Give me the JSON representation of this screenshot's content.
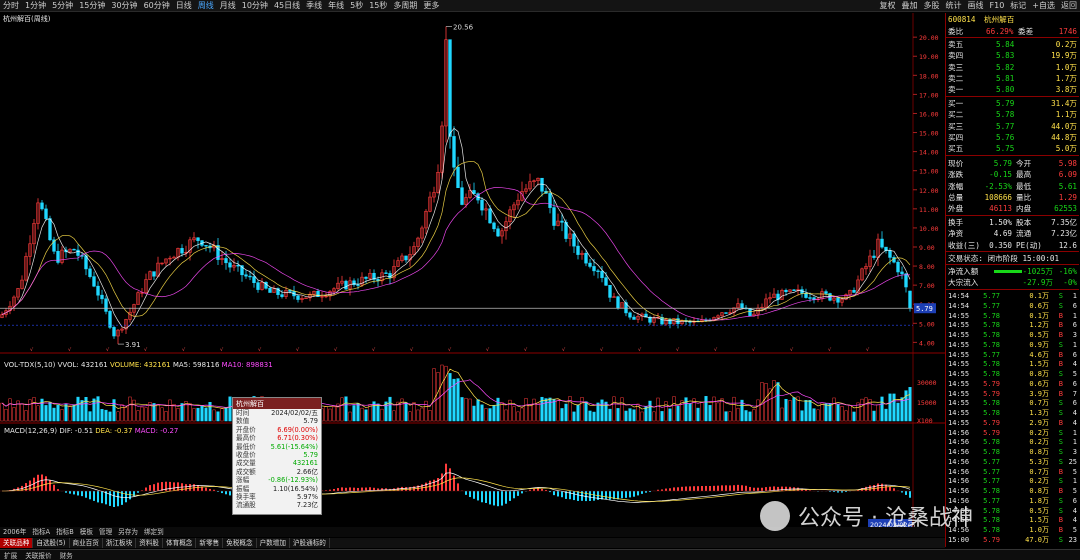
{
  "toolbar": {
    "left": [
      "分时",
      "1分钟",
      "5分钟",
      "15分钟",
      "30分钟",
      "60分钟",
      "日线",
      "周线",
      "月线",
      "10分钟",
      "45日线",
      "季线",
      "年线",
      "5秒",
      "15秒",
      "多周期",
      "更多"
    ],
    "active_index": 7,
    "right": [
      "复权",
      "叠加",
      "多股",
      "统计",
      "画线",
      "F10",
      "标记",
      "+自选",
      "返回"
    ]
  },
  "chart": {
    "title": "杭州解百(周线)",
    "price_high": "20.56",
    "price_low": "3.91",
    "current_price": "5.79",
    "y_ticks": [
      "20.00",
      "19.00",
      "18.00",
      "17.00",
      "16.00",
      "15.00",
      "14.00",
      "13.00",
      "12.00",
      "11.00",
      "10.00",
      "9.00",
      "8.00",
      "7.00",
      "6.00",
      "5.00",
      "4.00"
    ],
    "colors": {
      "up": "#ff3c3c",
      "down": "#20d8ff",
      "ma5": "#ffffff",
      "ma10": "#ffe14a",
      "ma20": "#ff4cff",
      "grid": "#6b0000"
    }
  },
  "volume": {
    "header": "VOL-TDX(5,10) VVOL: 432161",
    "volume_text": "VOLUME: 432161",
    "ma5_text": "MA5: 598116",
    "ma10_text": "MA10: 898831",
    "y_ticks": [
      "30000",
      "15000",
      "X100"
    ]
  },
  "macd": {
    "header": "MACD(12,26,9)",
    "dif_text": "DIF: -0.51",
    "dea_text": "DEA: -0.37",
    "macd_text": "MACD: -0.27"
  },
  "tooltip": {
    "title": "杭州解百",
    "rows": [
      {
        "k": "时间",
        "v": "2024/02/02/五",
        "c": "#222"
      },
      {
        "k": "数值",
        "v": "5.79",
        "c": "#222"
      },
      {
        "k": "开盘价",
        "v": "6.69(0.00%)",
        "c": "#e00000"
      },
      {
        "k": "最高价",
        "v": "6.71(0.30%)",
        "c": "#e00000"
      },
      {
        "k": "最低价",
        "v": "5.61(-15.64%)",
        "c": "#0a0"
      },
      {
        "k": "收盘价",
        "v": "5.79",
        "c": "#0a0"
      },
      {
        "k": "成交量",
        "v": "432161",
        "c": "#0a0"
      },
      {
        "k": "成交额",
        "v": "2.66亿",
        "c": "#222"
      },
      {
        "k": "涨幅",
        "v": "-0.86(-12.93%)",
        "c": "#0a0"
      },
      {
        "k": "振幅",
        "v": "1.10(16.54%)",
        "c": "#222"
      },
      {
        "k": "换手率",
        "v": "5.97%",
        "c": "#222"
      },
      {
        "k": "流通股",
        "v": "7.23亿",
        "c": "#222"
      }
    ]
  },
  "quote": {
    "code": "600814",
    "name": "杭州解百",
    "weibi": {
      "label": "委比",
      "value": "66.29%",
      "label2": "委差",
      "value2": "1746"
    },
    "asks": [
      {
        "label": "卖五",
        "price": "5.84",
        "vol": "0.2万"
      },
      {
        "label": "卖四",
        "price": "5.83",
        "vol": "19.9万"
      },
      {
        "label": "卖三",
        "price": "5.82",
        "vol": "1.0万"
      },
      {
        "label": "卖二",
        "price": "5.81",
        "vol": "1.7万"
      },
      {
        "label": "卖一",
        "price": "5.80",
        "vol": "3.8万"
      }
    ],
    "bids": [
      {
        "label": "买一",
        "price": "5.79",
        "vol": "31.4万"
      },
      {
        "label": "买二",
        "price": "5.78",
        "vol": "1.1万"
      },
      {
        "label": "买三",
        "price": "5.77",
        "vol": "44.0万"
      },
      {
        "label": "买四",
        "price": "5.76",
        "vol": "44.8万"
      },
      {
        "label": "买五",
        "price": "5.75",
        "vol": "5.0万"
      }
    ],
    "stats": [
      {
        "l1": "现价",
        "v1": "5.79",
        "c1": "grn",
        "l2": "今开",
        "v2": "5.98",
        "c2": "red"
      },
      {
        "l1": "涨跌",
        "v1": "-0.15",
        "c1": "grn",
        "l2": "最高",
        "v2": "6.09",
        "c2": "red"
      },
      {
        "l1": "涨幅",
        "v1": "-2.53%",
        "c1": "grn",
        "l2": "最低",
        "v2": "5.61",
        "c2": "grn"
      },
      {
        "l1": "总量",
        "v1": "108666",
        "c1": "yel",
        "l2": "量比",
        "v2": "1.29",
        "c2": "red"
      },
      {
        "l1": "外盘",
        "v1": "46113",
        "c1": "red",
        "l2": "内盘",
        "v2": "62553",
        "c2": "grn"
      }
    ],
    "stats2": [
      {
        "l1": "换手",
        "v1": "1.50%",
        "l2": "股本",
        "v2": "7.35亿"
      },
      {
        "l1": "净资",
        "v1": "4.69",
        "l2": "流通",
        "v2": "7.23亿"
      },
      {
        "l1": "收益(三)",
        "v1": "0.350",
        "l2": "PE(动)",
        "v2": "12.6"
      }
    ],
    "trade_status": "交易状态: 闭市阶段 15:00:01",
    "flow": [
      {
        "label": "净流入额",
        "value": "-1025万",
        "pct": "-16%"
      },
      {
        "label": "大宗流入",
        "value": "-27.9万",
        "pct": "-0%"
      }
    ],
    "ticks": [
      [
        "14:54",
        "5.77",
        "0.1万",
        "S",
        "1"
      ],
      [
        "14:54",
        "5.77",
        "0.6万",
        "S",
        "6"
      ],
      [
        "14:55",
        "5.78",
        "0.1万",
        "B",
        "1"
      ],
      [
        "14:55",
        "5.78",
        "1.2万",
        "B",
        "6"
      ],
      [
        "14:55",
        "5.78",
        "0.5万",
        "B",
        "3"
      ],
      [
        "14:55",
        "5.78",
        "0.9万",
        "S",
        "1"
      ],
      [
        "14:55",
        "5.77",
        "4.6万",
        "B",
        "6"
      ],
      [
        "14:55",
        "5.78",
        "1.5万",
        "B",
        "4"
      ],
      [
        "14:55",
        "5.78",
        "0.8万",
        "S",
        "5"
      ],
      [
        "14:55",
        "5.79",
        "0.6万",
        "B",
        "6"
      ],
      [
        "14:55",
        "5.79",
        "3.9万",
        "B",
        "7"
      ],
      [
        "14:55",
        "5.78",
        "0.7万",
        "S",
        "6"
      ],
      [
        "14:55",
        "5.78",
        "1.3万",
        "S",
        "4"
      ],
      [
        "14:55",
        "5.79",
        "2.9万",
        "B",
        "4"
      ],
      [
        "14:56",
        "5.79",
        "0.2万",
        "S",
        "1"
      ],
      [
        "14:56",
        "5.78",
        "0.2万",
        "S",
        "1"
      ],
      [
        "14:56",
        "5.78",
        "0.8万",
        "S",
        "3"
      ],
      [
        "14:56",
        "5.77",
        "5.3万",
        "S",
        "25"
      ],
      [
        "14:56",
        "5.77",
        "0.7万",
        "B",
        "5"
      ],
      [
        "14:56",
        "5.77",
        "0.2万",
        "S",
        "1"
      ],
      [
        "14:56",
        "5.78",
        "0.8万",
        "B",
        "5"
      ],
      [
        "14:56",
        "5.77",
        "1.8万",
        "S",
        "6"
      ],
      [
        "14:56",
        "5.78",
        "0.5万",
        "S",
        "4"
      ],
      [
        "14:56",
        "5.78",
        "1.5万",
        "B",
        "4"
      ],
      [
        "14:56",
        "5.78",
        "1.0万",
        "B",
        "5"
      ],
      [
        "15:00",
        "5.79",
        "47.0万",
        "S",
        "23"
      ]
    ]
  },
  "bottom_tabs": [
    "关联品种",
    "自选股(5)",
    "商业百货",
    "浙江板块",
    "资料股",
    "体育概念",
    "新零售",
    "免税概念",
    "户数增加",
    "沪股通标的"
  ],
  "bar2_items": [
    "指标A",
    "指标B",
    "模板",
    "管理",
    "另存为",
    "绑定到"
  ],
  "status": [
    "扩展",
    "关联报价",
    "财务"
  ],
  "watermark": "公众号 · 沧桑战神",
  "x_label_date": "2024/02/02/五",
  "year_label": "2006年"
}
